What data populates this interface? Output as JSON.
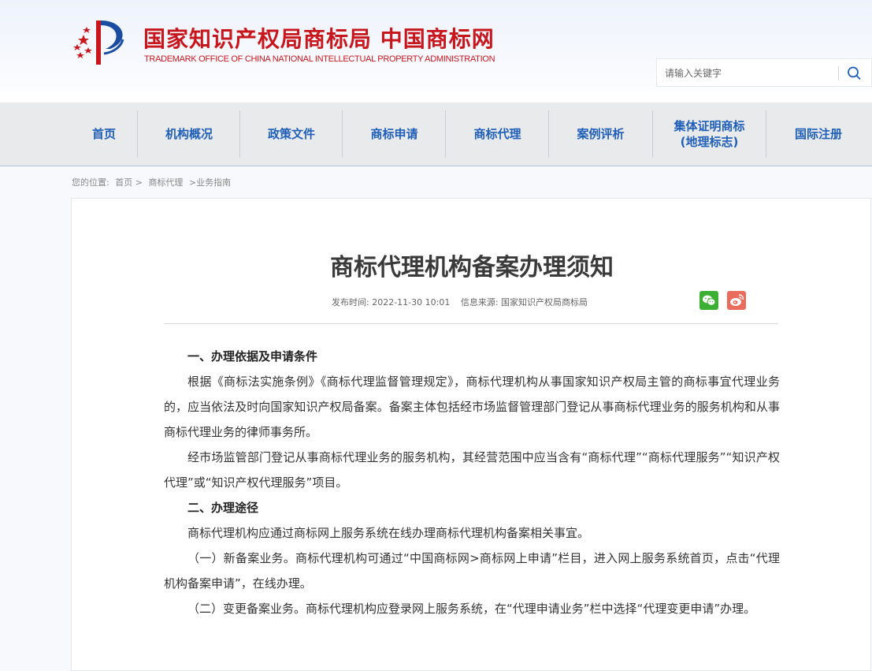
{
  "header": {
    "title": "国家知识产权局商标局 中国商标网",
    "subtitle": "TRADEMARK OFFICE OF CHINA NATIONAL INTELLECTUAL PROPERTY ADMINISTRATION",
    "logo_icon": "cnipa-emblem-icon",
    "brand_color": "#c8161d",
    "search": {
      "placeholder": "请输入关键字",
      "icon": "search-icon"
    }
  },
  "nav": {
    "accent": "#1f5fb8",
    "items": [
      {
        "label": "首页"
      },
      {
        "label": "机构概况"
      },
      {
        "label": "政策文件"
      },
      {
        "label": "商标申请"
      },
      {
        "label": "商标代理"
      },
      {
        "label": "案例评析"
      },
      {
        "label": "集体证明商标\n(地理标志)"
      },
      {
        "label": "国际注册"
      }
    ]
  },
  "breadcrumb": {
    "prefix": "您的位置:",
    "items": [
      "首页 >",
      "商标代理",
      ">业务指南"
    ]
  },
  "article": {
    "title": "商标代理机构备案办理须知",
    "publish_time": "发布时间: 2022-11-30 10:01",
    "source": "信息来源: 国家知识产权局商标局",
    "share": [
      {
        "icon": "wechat-icon",
        "color": "#3cb034"
      },
      {
        "icon": "weibo-icon",
        "color": "#e96c5d"
      }
    ],
    "paragraphs": [
      {
        "type": "heading",
        "text": " 一、办理依据及申请条件"
      },
      {
        "type": "text",
        "text": "根据《商标法实施条例》《商标代理监督管理规定》，商标代理机构从事国家知识产权局主管的商标事宜代理业务的，应当依法及时向国家知识产权局备案。备案主体包括经市场监督管理部门登记从事商标代理业务的服务机构和从事商标代理业务的律师事务所。"
      },
      {
        "type": "text",
        "text": "经市场监管部门登记从事商标代理业务的服务机构，其经营范围中应当含有“商标代理”“商标代理服务”“知识产权代理”或“知识产权代理服务”项目。"
      },
      {
        "type": "heading",
        "text": "二、办理途径"
      },
      {
        "type": "text",
        "text": "商标代理机构应通过商标网上服务系统在线办理商标代理机构备案相关事宜。"
      },
      {
        "type": "text",
        "text": "（一）新备案业务。商标代理机构可通过“中国商标网>商标网上申请”栏目，进入网上服务系统首页，点击“代理机构备案申请”，在线办理。"
      },
      {
        "type": "text",
        "text": "（二）变更备案业务。商标代理机构应登录网上服务系统，在“代理申请业务”栏中选择“代理变更申请”办理。"
      }
    ]
  }
}
